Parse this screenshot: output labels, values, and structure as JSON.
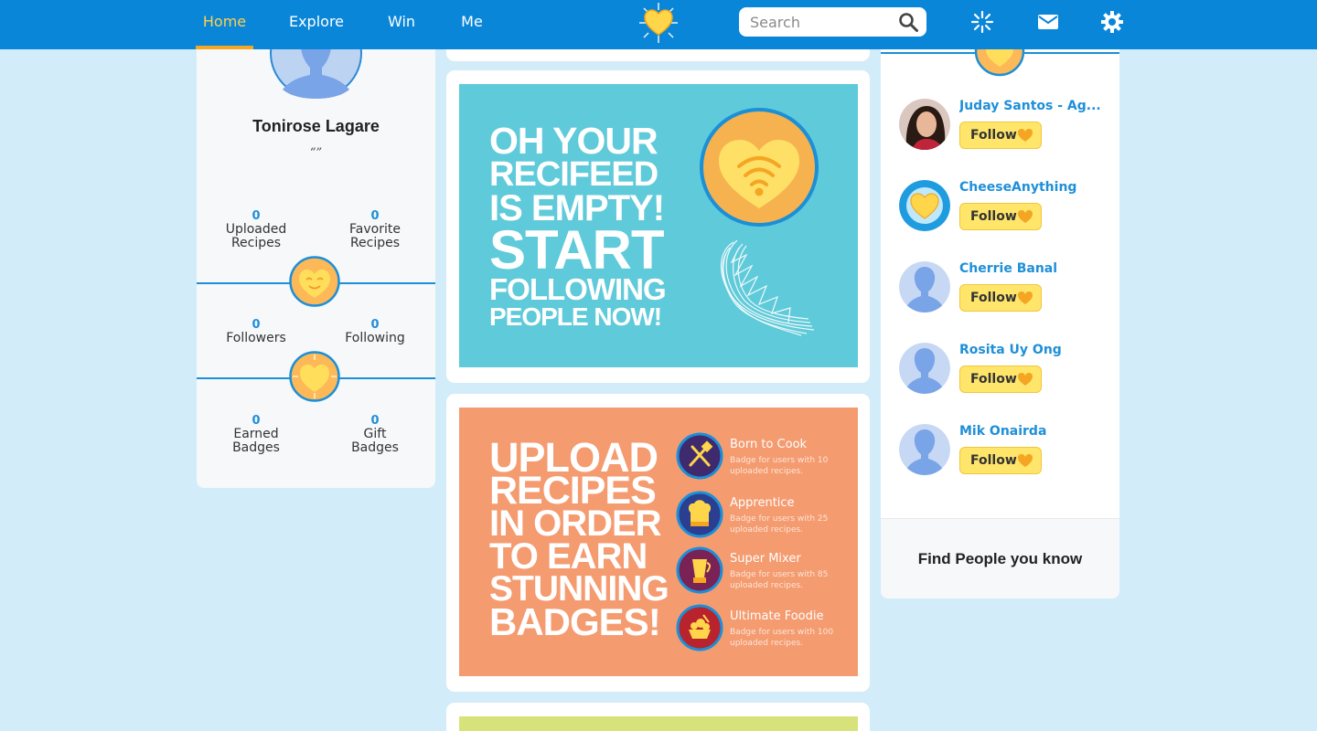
{
  "nav": {
    "tabs": [
      {
        "label": "Home",
        "active": true
      },
      {
        "label": "Explore",
        "active": false
      },
      {
        "label": "Win",
        "active": false
      },
      {
        "label": "Me",
        "active": false
      }
    ],
    "search_placeholder": "Search",
    "icons": [
      "logo-heart-icon",
      "search-icon",
      "notifications-burst-icon",
      "mail-icon",
      "settings-gear-icon"
    ]
  },
  "profile": {
    "name": "Tonirose Lagare",
    "quote": "“”",
    "stats": {
      "uploaded": {
        "value": "0",
        "label_1": "Uploaded",
        "label_2": "Recipes"
      },
      "favorite": {
        "value": "0",
        "label_1": "Favorite",
        "label_2": "Recipes"
      },
      "followers": {
        "value": "0",
        "label_1": "Followers"
      },
      "following": {
        "value": "0",
        "label_1": "Following"
      },
      "earned": {
        "value": "0",
        "label_1": "Earned",
        "label_2": "Badges"
      },
      "gift": {
        "value": "0",
        "label_1": "Gift",
        "label_2": "Badges"
      }
    }
  },
  "feed": {
    "empty_banner": {
      "lines": [
        "OH YOUR",
        "RECIFEED",
        "IS EMPTY!",
        "START",
        "FOLLOWING",
        "PEOPLE NOW!"
      ]
    },
    "badges_banner": {
      "lines": [
        "UPLOAD",
        "RECIPES",
        "IN ORDER",
        "TO EARN",
        "STUNNING",
        "BADGES!"
      ],
      "badges": [
        {
          "title": "Born to Cook",
          "desc": "Badge for users with 10 uploaded recipes.",
          "icon": "spatula-icon",
          "color": "#3f2a6e"
        },
        {
          "title": "Apprentice",
          "desc": "Badge for users with 25 uploaded recipes.",
          "icon": "chef-hat-icon",
          "color": "#2b3e8f"
        },
        {
          "title": "Super Mixer",
          "desc": "Badge for users  with 85 uploaded recipes.",
          "icon": "mixer-icon",
          "color": "#7a2155"
        },
        {
          "title": "Ultimate Foodie",
          "desc": "Badge for users  with 100 uploaded recipes.",
          "icon": "dish-icon",
          "color": "#b8232d"
        }
      ]
    }
  },
  "suggestions": {
    "people": [
      {
        "name": "Juday Santos - Ag...",
        "follow": "Follow",
        "avatar": "photo"
      },
      {
        "name": "CheeseAnything",
        "follow": "Follow",
        "avatar": "logo"
      },
      {
        "name": "Cherrie Banal",
        "follow": "Follow",
        "avatar": "default"
      },
      {
        "name": "Rosita Uy Ong",
        "follow": "Follow",
        "avatar": "default"
      },
      {
        "name": "Mik Onairda",
        "follow": "Follow",
        "avatar": "default"
      }
    ],
    "find_people": "Find People you know"
  },
  "colors": {
    "topbar": "#0a86d9",
    "accent": "#f5a623",
    "link": "#1f8fd8",
    "blue_banner": "#5fcad9",
    "orange_banner": "#f49b70",
    "follow_button": "#ffe66b"
  }
}
